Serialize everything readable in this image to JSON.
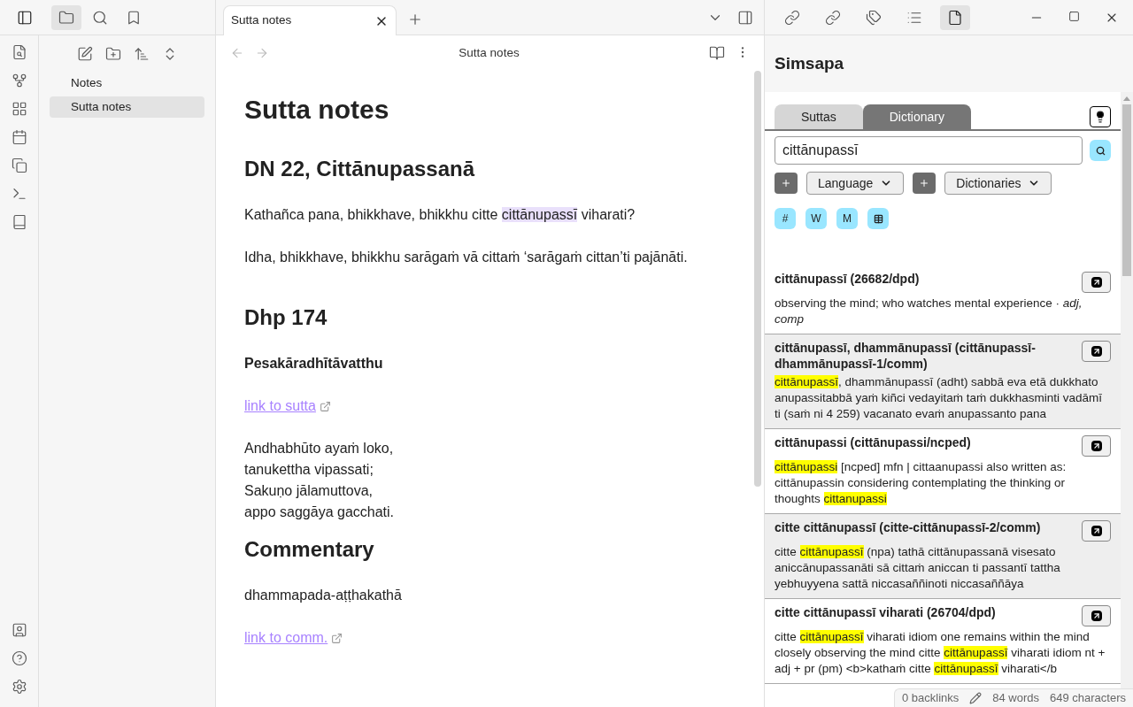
{
  "left_sidebar": {
    "tabs": [
      {
        "selected": true
      },
      {
        "selected": false
      },
      {
        "selected": false
      }
    ],
    "file_tree": [
      {
        "label": "Notes",
        "selected": false
      },
      {
        "label": "Sutta notes",
        "selected": true
      }
    ]
  },
  "editor": {
    "tab": {
      "label": "Sutta notes",
      "selected": true
    },
    "title": "Sutta notes",
    "blocks": [
      {
        "kind": "h1",
        "text": "Sutta notes"
      },
      {
        "kind": "h2",
        "text": "DN 22, Cittānupassanā"
      },
      {
        "kind": "p",
        "parts": [
          {
            "text": "Kathañca pana, bhikkhave, bhikkhu citte ",
            "highlighted": false
          },
          {
            "text": "cittānupassī",
            "highlighted": true
          },
          {
            "text": " viharati?",
            "highlighted": false
          }
        ]
      },
      {
        "kind": "p",
        "parts": [
          {
            "text": "Idha, bhikkhave, bhikkhu sarāgaṁ vā cittaṁ ‘sarāgaṁ cittan’ti pajānāti.",
            "highlighted": false
          }
        ]
      },
      {
        "kind": "h2",
        "text": "Dhp 174"
      },
      {
        "kind": "strong",
        "text": "Pesakāradhītāvatthu"
      },
      {
        "kind": "link",
        "text": "link to sutta"
      },
      {
        "kind": "verse",
        "lines": [
          "Andhabhūto ayaṁ loko,",
          "tanukettha vipassati;",
          "Sakuṇo jālamuttova,",
          "appo saggāya gacchati."
        ]
      },
      {
        "kind": "h2",
        "text": "Commentary"
      },
      {
        "kind": "p",
        "parts": [
          {
            "text": "dhammapada-aṭṭhakathā",
            "highlighted": false
          }
        ]
      },
      {
        "kind": "link",
        "text": "link to comm."
      }
    ]
  },
  "right_sidebar": {
    "tabs": [
      {
        "selected": false
      },
      {
        "selected": false
      },
      {
        "selected": false
      },
      {
        "selected": false
      },
      {
        "selected": true
      }
    ],
    "title": "Simsapa"
  },
  "simsapa": {
    "tabs": [
      {
        "label": "Suttas",
        "selected": false
      },
      {
        "label": "Dictionary",
        "selected": true
      }
    ],
    "search": {
      "value": "cittānupassī"
    },
    "selects": [
      {
        "label": "Language"
      },
      {
        "label": "Dictionaries"
      }
    ],
    "filters": [
      {
        "kind": "text",
        "label": "#"
      },
      {
        "kind": "text",
        "label": "W"
      },
      {
        "kind": "text",
        "label": "M"
      },
      {
        "kind": "icon"
      }
    ],
    "results": [
      {
        "title": "cittānupassī (26682/dpd)",
        "parts": [
          {
            "text": "observing the mind; who watches mental experience · *adj, comp*",
            "highlighted": false
          }
        ]
      },
      {
        "title": "cittānupassī, dhammānupassī (cittānupassī-dhammānupassī-1/comm)",
        "parts": [
          {
            "text": "cittānupassī",
            "highlighted": true
          },
          {
            "text": ", dhammānupassī (adht) sabbā eva etā dukkhato anupassitabbā yaṁ kiñci vedayitaṁ taṁ dukkhasminti vadāmī ti (saṁ ni 4 259) vacanato evaṁ anupassanto pana",
            "highlighted": false
          }
        ]
      },
      {
        "title": "cittānupassi (cittānupassi/ncped)",
        "parts": [
          {
            "text": "cittānupassi",
            "highlighted": true
          },
          {
            "text": " [ncped] mfn | cittaanupassi also written as: cittānupassin considering contemplating the thinking or thoughts ",
            "highlighted": false
          },
          {
            "text": "cittanupassi",
            "highlighted": true
          }
        ]
      },
      {
        "title": "citte cittānupassī (citte-cittānupassī-2/comm)",
        "parts": [
          {
            "text": "citte ",
            "highlighted": false
          },
          {
            "text": "cittānupassī",
            "highlighted": true
          },
          {
            "text": " (npa) tathā cittānupassanā visesato aniccānupassanāti sā cittaṁ aniccan ti passantī tattha yebhuyyena sattā niccasaññinoti niccasaññāya",
            "highlighted": false
          }
        ]
      },
      {
        "title": "citte cittānupassī viharati (26704/dpd)",
        "parts": [
          {
            "text": "citte ",
            "highlighted": false
          },
          {
            "text": "cittānupassī",
            "highlighted": true
          },
          {
            "text": " viharati idiom one remains within the mind closely observing the mind citte ",
            "highlighted": false
          },
          {
            "text": "cittānupassī",
            "highlighted": true
          },
          {
            "text": " viharati idiom nt + adj + pr (pm) <b>kathaṁ citte ",
            "highlighted": false
          },
          {
            "text": "cittānupassī",
            "highlighted": true
          },
          {
            "text": " viharati</b",
            "highlighted": false
          }
        ]
      }
    ]
  },
  "status_bar": {
    "backlinks": "0 backlinks",
    "words": "84 words",
    "characters": "649 characters"
  }
}
